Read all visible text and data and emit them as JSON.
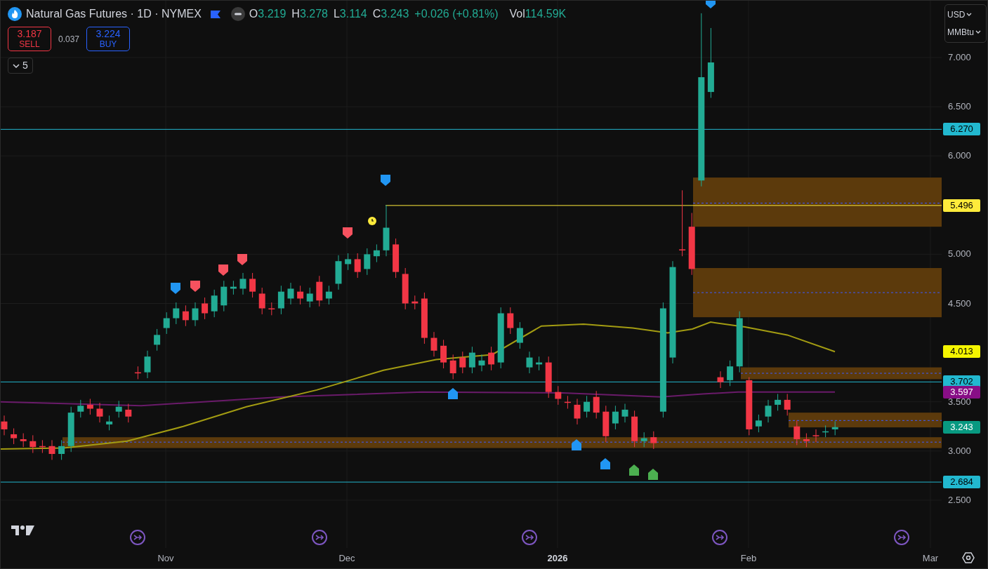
{
  "header": {
    "symbol": "Natural Gas Futures · 1D · NYMEX",
    "ohlc": [
      {
        "label": "O",
        "value": "3.219"
      },
      {
        "label": "H",
        "value": "3.278"
      },
      {
        "label": "L",
        "value": "3.114"
      },
      {
        "label": "C",
        "value": "3.243"
      }
    ],
    "change": "+0.026 (+0.81%)",
    "volume_label": "Vol",
    "volume": "114.59K"
  },
  "trade": {
    "sell_price": "3.187",
    "sell_label": "SELL",
    "spread": "0.037",
    "buy_price": "3.224",
    "buy_label": "BUY"
  },
  "indicators_toggle": "5",
  "currency": "USD",
  "unit": "MMBtu",
  "price_axis": [
    "7.000",
    "6.500",
    "6.000",
    "5.000",
    "4.500",
    "3.500",
    "3.000",
    "2.500"
  ],
  "price_tags": [
    {
      "value": "6.270",
      "color": "#22b8cf",
      "kind": "line"
    },
    {
      "value": "5.496",
      "color": "#ffeb3b",
      "kind": "level"
    },
    {
      "value": "4.013",
      "color": "#f5f500",
      "kind": "ma"
    },
    {
      "value": "3.702",
      "color": "#22b8cf",
      "kind": "line"
    },
    {
      "value": "3.597",
      "color": "#880e86",
      "kind": "ma"
    },
    {
      "value": "3.243",
      "color": "#089981",
      "kind": "last"
    },
    {
      "value": "2.684",
      "color": "#22b8cf",
      "kind": "line"
    }
  ],
  "time_axis": [
    {
      "label": "Nov",
      "bold": false
    },
    {
      "label": "Dec",
      "bold": false
    },
    {
      "label": "2026",
      "bold": true
    },
    {
      "label": "Feb",
      "bold": false
    },
    {
      "label": "Mar",
      "bold": false
    }
  ]
}
